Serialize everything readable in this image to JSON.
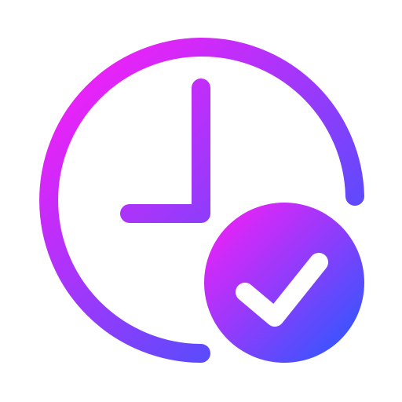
{
  "icon": {
    "name": "clock-check-icon",
    "components": [
      "clock-outline",
      "clock-hands",
      "check-badge"
    ],
    "gradient": {
      "start_color": "#ff1cf7",
      "end_color": "#1f5cff"
    },
    "background_color": "#ffffff",
    "check_color": "#ffffff"
  }
}
